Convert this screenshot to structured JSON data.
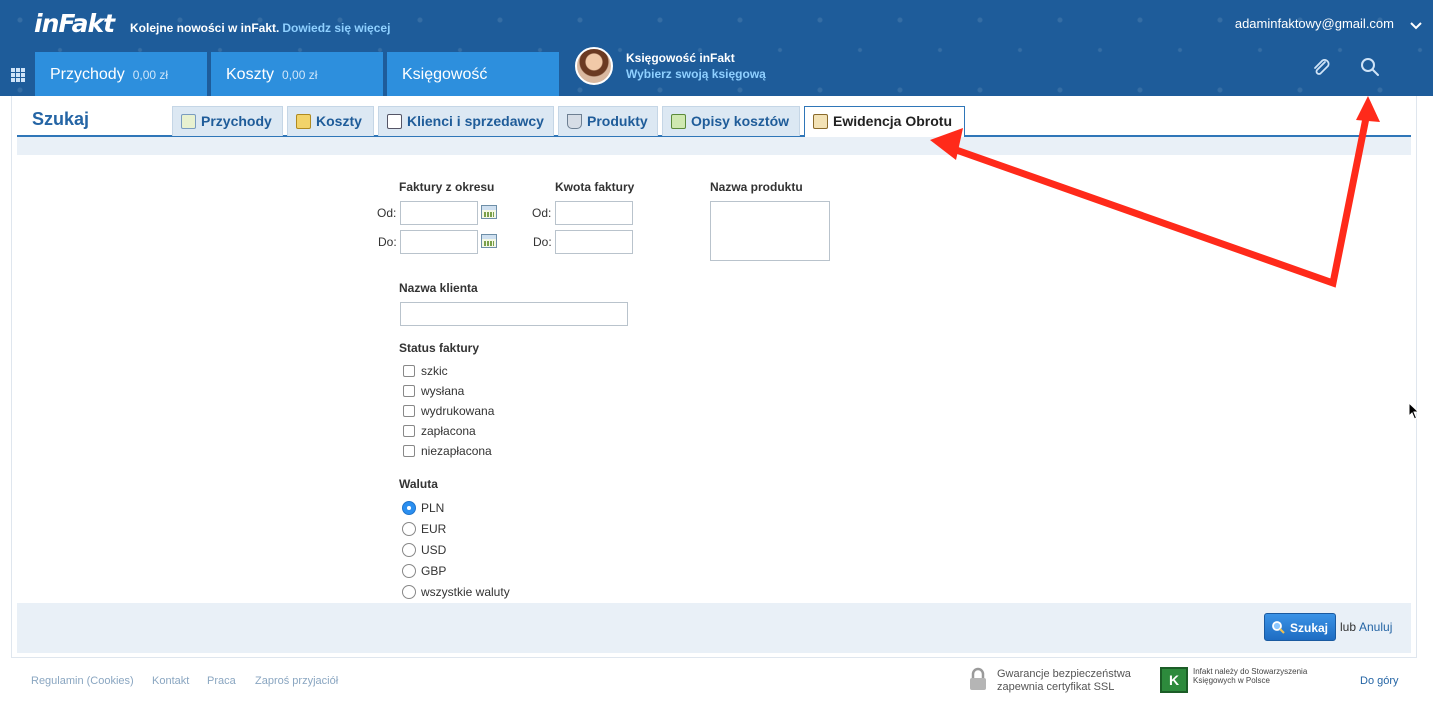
{
  "header": {
    "logo": "inFakt",
    "news_text": "Kolejne nowości w inFakt.",
    "news_link": "Dowiedz się więcej",
    "user_email": "adaminfaktowy@gmail.com",
    "nav": [
      {
        "label": "Przychody",
        "amount": "0,00 zł"
      },
      {
        "label": "Koszty",
        "amount": "0,00 zł"
      },
      {
        "label": "Księgowość",
        "amount": ""
      }
    ],
    "accountant_title": "Księgowość inFakt",
    "accountant_sub": "Wybierz swoją księgową"
  },
  "search": {
    "title": "Szukaj",
    "tabs": [
      {
        "label": "Przychody",
        "icon": "invoice-search-icon"
      },
      {
        "label": "Koszty",
        "icon": "costs-icon"
      },
      {
        "label": "Klienci i sprzedawcy",
        "icon": "contacts-icon"
      },
      {
        "label": "Produkty",
        "icon": "basket-icon"
      },
      {
        "label": "Opisy kosztów",
        "icon": "cost-descriptions-icon"
      },
      {
        "label": "Ewidencja Obrotu",
        "icon": "book-icon"
      }
    ],
    "active_tab": "Ewidencja Obrotu",
    "period_label": "Faktury z okresu",
    "amount_label": "Kwota faktury",
    "from_label": "Od:",
    "to_label": "Do:",
    "product_label": "Nazwa produktu",
    "client_label": "Nazwa klienta",
    "status_label": "Status faktury",
    "statuses": [
      "szkic",
      "wysłana",
      "wydrukowana",
      "zapłacona",
      "niezapłacona"
    ],
    "currency_label": "Waluta",
    "currencies": [
      "PLN",
      "EUR",
      "USD",
      "GBP",
      "wszystkie waluty"
    ],
    "selected_currency": "PLN",
    "search_button": "Szukaj",
    "or_text": "lub",
    "cancel_link": "Anuluj"
  },
  "footer": {
    "links": [
      "Regulamin (Cookies)",
      "Kontakt",
      "Praca",
      "Zaproś przyjaciół"
    ],
    "ssl_text": "Gwarancje bezpieczeństwa zapewnia certyfikat SSL",
    "sk_text": "Infakt należy do Stowarzyszenia Księgowych w Polsce",
    "to_top": "Do góry"
  },
  "colors": {
    "header_bg": "#1e5c9a",
    "nav_tab": "#2d8fdd",
    "link": "#2565a5",
    "annotation_arrow": "#ff2a1a"
  }
}
